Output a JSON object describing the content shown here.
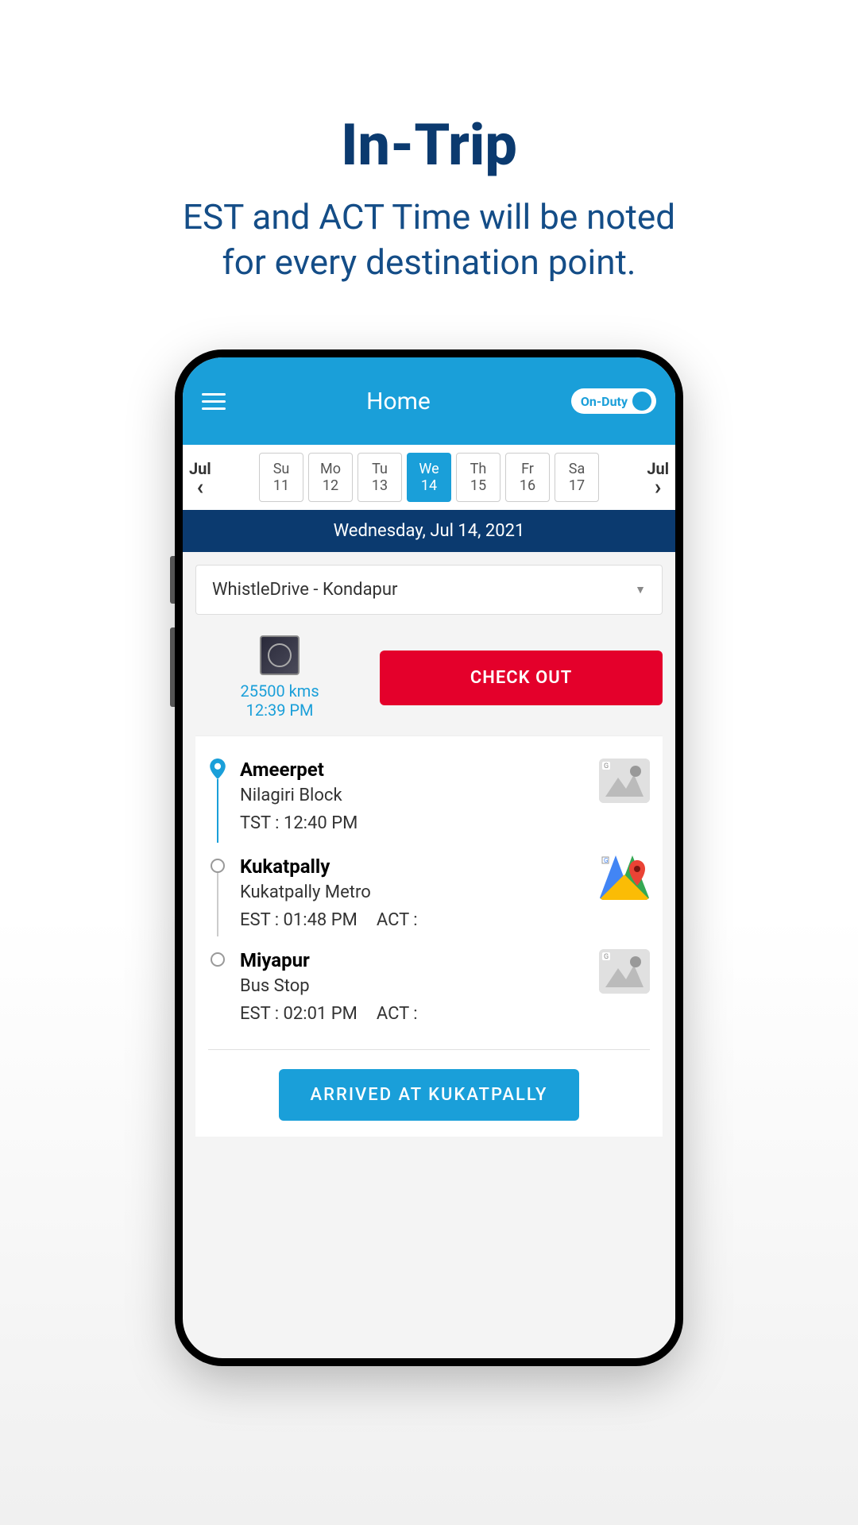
{
  "promo": {
    "title": "In-Trip",
    "subtitle_line1": "EST and ACT Time will be noted",
    "subtitle_line2": "for every destination point."
  },
  "header": {
    "title": "Home",
    "duty_label": "On-Duty"
  },
  "calendar": {
    "month_left": "Jul",
    "month_right": "Jul",
    "days": [
      {
        "name": "Su",
        "num": "11",
        "selected": false
      },
      {
        "name": "Mo",
        "num": "12",
        "selected": false
      },
      {
        "name": "Tu",
        "num": "13",
        "selected": false
      },
      {
        "name": "We",
        "num": "14",
        "selected": true
      },
      {
        "name": "Th",
        "num": "15",
        "selected": false
      },
      {
        "name": "Fr",
        "num": "16",
        "selected": false
      },
      {
        "name": "Sa",
        "num": "17",
        "selected": false
      }
    ],
    "full_date": "Wednesday,  Jul 14, 2021"
  },
  "dropdown": {
    "selected": "WhistleDrive - Kondapur"
  },
  "odometer": {
    "kms": "25500 kms",
    "time": "12:39 PM"
  },
  "checkout_label": "CHECK OUT",
  "stops": [
    {
      "name": "Ameerpet",
      "sub": "Nilagiri Block",
      "time_label": "TST : 12:40 PM",
      "act_label": "",
      "marker": "pin",
      "map": "gray"
    },
    {
      "name": "Kukatpally",
      "sub": "Kukatpally Metro",
      "time_label": "EST : 01:48 PM",
      "act_label": "ACT :",
      "marker": "circle",
      "map": "color"
    },
    {
      "name": "Miyapur",
      "sub": "Bus Stop",
      "time_label": "EST : 02:01 PM",
      "act_label": "ACT :",
      "marker": "circle",
      "map": "gray"
    }
  ],
  "arrived_label": "ARRIVED AT KUKATPALLY"
}
